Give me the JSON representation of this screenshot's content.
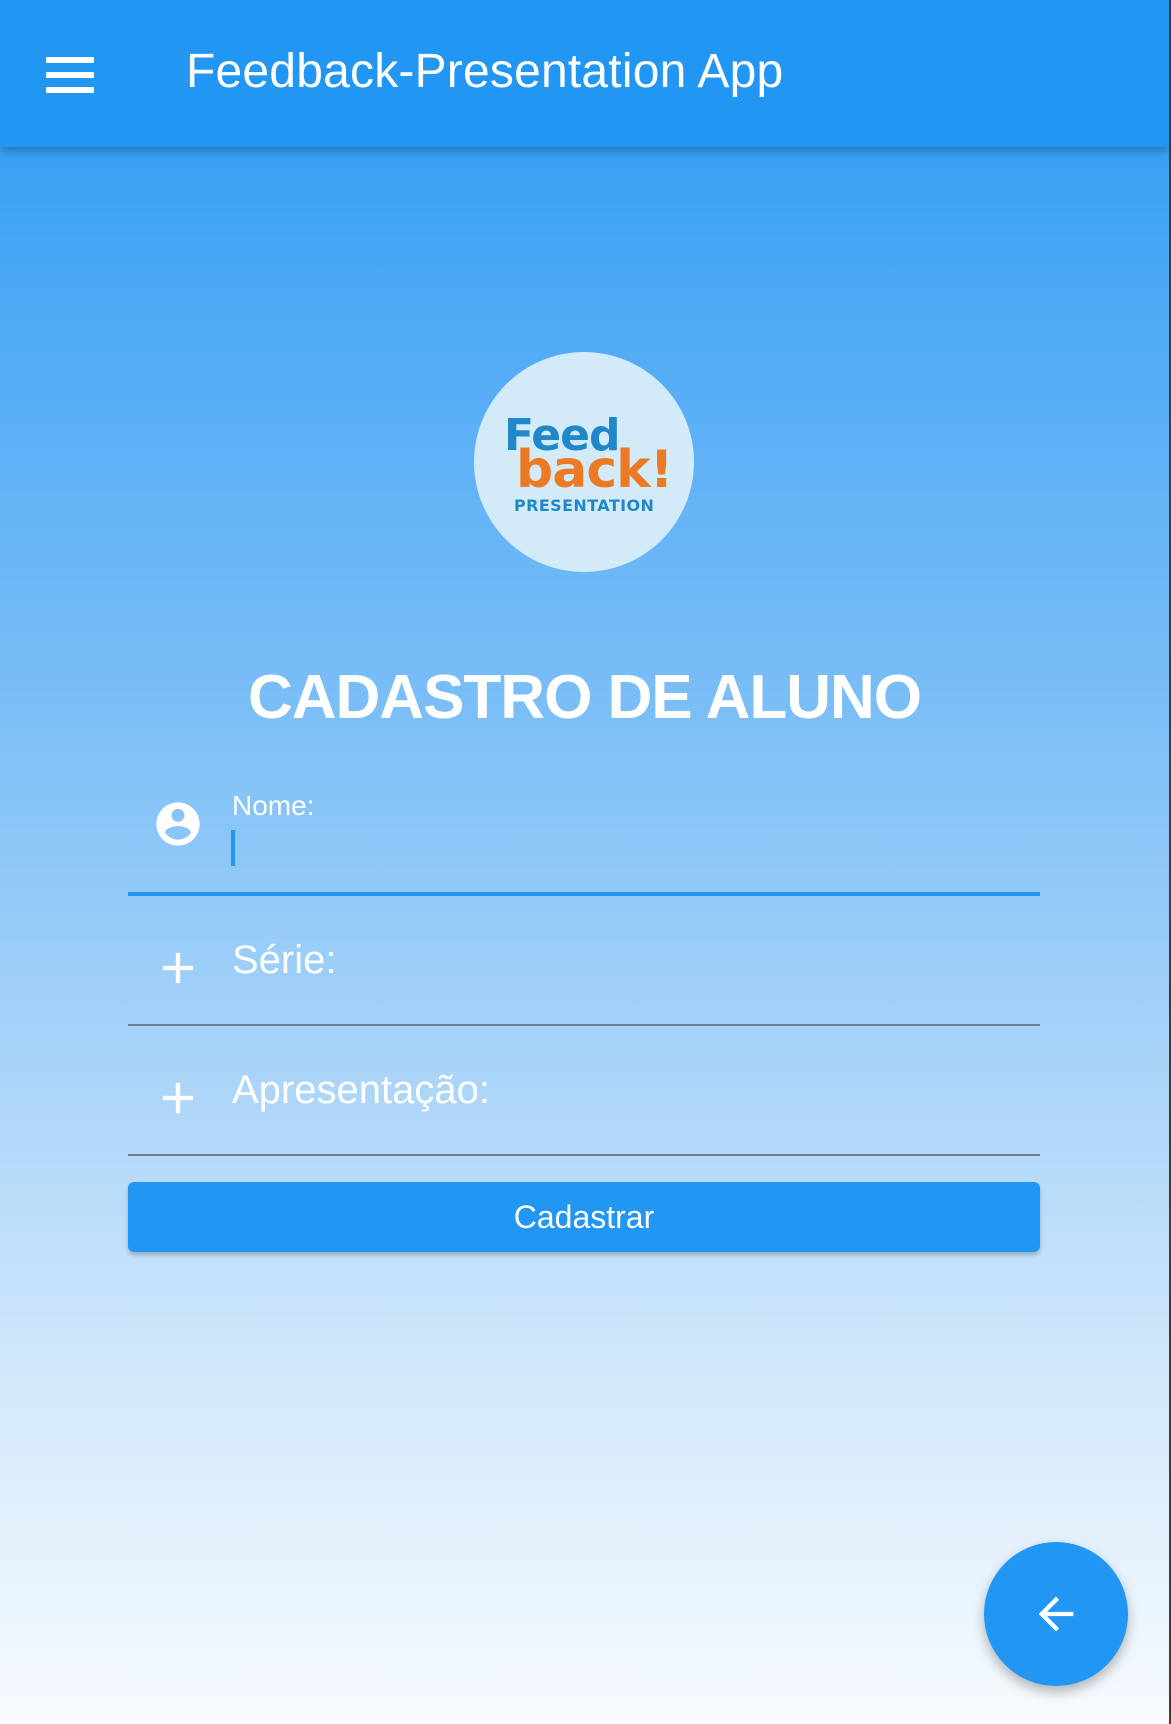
{
  "appbar": {
    "title": "Feedback-Presentation App",
    "menu_icon": "hamburger-menu-icon",
    "background_color": "#2196f3"
  },
  "logo": {
    "line1": "Feed",
    "line2": "back!",
    "line3": "PRESENTATION",
    "colors": {
      "circle": "#d3ebf9",
      "feed": "#1f88c9",
      "back": "#ec7a25",
      "presentation": "#1f88c9"
    }
  },
  "form": {
    "title": "CADASTRO DE ALUNO",
    "fields": {
      "nome": {
        "label": "Nome:",
        "value": "",
        "icon": "account-circle-icon",
        "focused": true
      },
      "serie": {
        "label": "Série:",
        "value": "",
        "icon": "plus-icon"
      },
      "apresentacao": {
        "label": "Apresentação:",
        "value": "",
        "icon": "plus-icon"
      }
    },
    "submit_label": "Cadastrar"
  },
  "fab": {
    "icon": "arrow-back-icon"
  },
  "colors": {
    "primary": "#2196f3",
    "text_on_primary": "#ffffff"
  }
}
